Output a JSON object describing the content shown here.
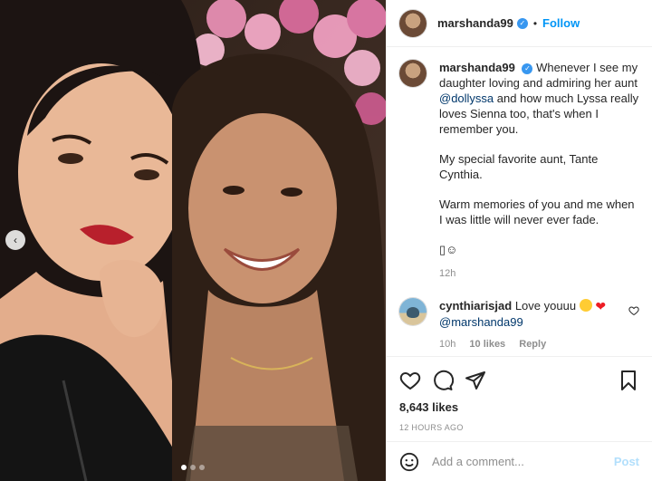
{
  "post": {
    "author": "marshanda99",
    "follow_separator": "•",
    "follow_label": "Follow",
    "caption_paragraphs": [
      {
        "before": "Whenever I see my daughter loving and admiring her aunt ",
        "mention": "@dollyssa",
        "after": " and how much Lyssa really loves Sienna too, that's when I remember you."
      },
      {
        "text": "My special favorite aunt, Tante Cynthia."
      },
      {
        "text": "Warm memories of you and me when I was little will never ever fade."
      },
      {
        "text": "▯☺"
      }
    ],
    "caption_time": "12h",
    "likes": "8,643 likes",
    "posted_ago": "12 HOURS AGO"
  },
  "comment": {
    "author": "cynthiarisjad",
    "text": "Love youuu",
    "mention": "@marshanda99",
    "time": "10h",
    "likes": "10 likes",
    "reply_label": "Reply"
  },
  "add_comment": {
    "placeholder": "Add a comment...",
    "post_label": "Post"
  },
  "carousel": {
    "prev_glyph": "‹",
    "slide_count": 3,
    "active_index": 0
  },
  "colors": {
    "accent": "#0095f6",
    "mention": "#00376b",
    "muted": "#8e8e8e",
    "verified": "#3897f0",
    "post_disabled": "#b2dffc"
  }
}
